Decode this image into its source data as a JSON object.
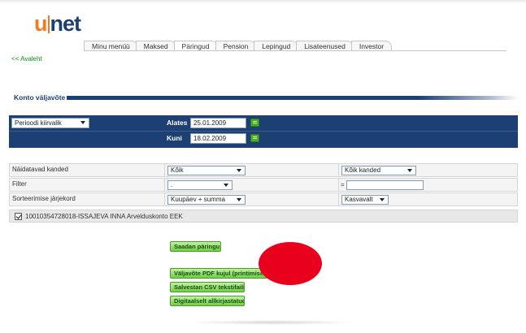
{
  "logo": {
    "left": "u",
    "right": "net"
  },
  "tabs": [
    {
      "label": "Minu menüü"
    },
    {
      "label": "Maksed"
    },
    {
      "label": "Päringud"
    },
    {
      "label": "Pension"
    },
    {
      "label": "Lepingud"
    },
    {
      "label": "Lisateenused"
    },
    {
      "label": "Investor"
    }
  ],
  "active_tab": "Päringud",
  "back_link": "<< Avaleht",
  "section_title": "Konto väljavõte",
  "period": {
    "select_value": "Perioodi kiirvalik",
    "from_label": "Alates",
    "from_value": "25.01.2009",
    "to_label": "Kuni",
    "to_value": "18.02.2009"
  },
  "filters": {
    "rows": [
      {
        "label": "Näidatavad kanded",
        "select1": "Kõik",
        "select2": "Kõik kanded"
      },
      {
        "label": "Filter",
        "select1": ".",
        "eq": "="
      },
      {
        "label": "Sorteerimise järjekord",
        "select1": "Kuupäev + summa",
        "select2": "Kasvavalt"
      }
    ]
  },
  "account": {
    "checked": true,
    "label": "10010354728018-ISSAJEVA INNA Arvelduskonto EEK"
  },
  "buttons": {
    "send": "Saadan päringu",
    "pdf": "Väljavõte PDF kujul (printimiseks)",
    "csv": "Salvestan CSV tekstifaili",
    "signed": "Digitaalselt allkirjastatud"
  },
  "colors": {
    "brand_orange": "#f47920",
    "brand_navy": "#1c3f74",
    "button_green": "#6fcf42",
    "overlay_red": "#e8001c"
  }
}
